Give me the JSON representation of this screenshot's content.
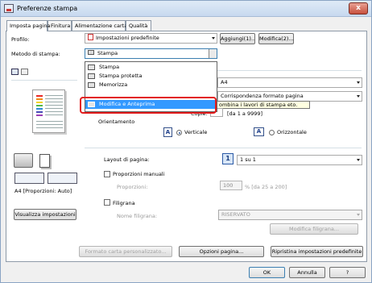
{
  "window": {
    "title": "Preferenze stampa",
    "close_label": "x"
  },
  "tabs": [
    {
      "label": "Imposta pagina"
    },
    {
      "label": "Finitura"
    },
    {
      "label": "Alimentazione carta"
    },
    {
      "label": "Qualità"
    }
  ],
  "profile": {
    "label": "Profilo:",
    "value": "Impostazioni predefinite",
    "add_button": "Aggiungi(1)...",
    "edit_button": "Modifica(2)..."
  },
  "print_method": {
    "label": "Metodo di stampa:",
    "value": "Stampa"
  },
  "dropdown": {
    "items": [
      {
        "label": "Stampa",
        "icon": "printer-icon"
      },
      {
        "label": "Stampa protetta",
        "icon": "secure-print-icon"
      },
      {
        "label": "Memorizza",
        "icon": "store-icon"
      },
      {
        "label": "Modifica e Anteprima",
        "icon": "edit-preview-icon",
        "selected": true
      }
    ]
  },
  "page_size": {
    "value": "A4"
  },
  "output_size": {
    "value": "Corrispondenza formato pagina"
  },
  "combine_tooltip": "ombina i lavori di stampa eto.",
  "copies": {
    "label": "Copie:",
    "hint": "[da 1 a 9999]"
  },
  "orientation": {
    "label": "Orientamento",
    "portrait_label": "Verticale",
    "landscape_label": "Orizzontale",
    "selected": "portrait"
  },
  "layout": {
    "label": "Layout di pagina:",
    "number": "1",
    "value": "1 su 1"
  },
  "manual_scaling": {
    "label": "Proporzioni manuali",
    "sub_label": "Proporzioni:",
    "value": "100",
    "hint": "% [da 25 a 200]"
  },
  "watermark": {
    "label": "Filigrana",
    "name_label": "Nome filigrana:",
    "value": "RISERVATO",
    "edit_button": "Modifica filigrana..."
  },
  "preview_caption": "A4 [Proporzioni: Auto]",
  "view_settings_button": "Visualizza impostazioni",
  "custom_paper_button": "Formato carta personalizzato...",
  "page_options_button": "Opzioni pagina...",
  "restore_defaults_button": "Ripristina impostazioni predefinite",
  "footer": {
    "ok": "OK",
    "cancel": "Annulla",
    "help": "?"
  },
  "colors": {
    "accent": "#3399ff",
    "highlight_ring": "#e21b1b"
  }
}
